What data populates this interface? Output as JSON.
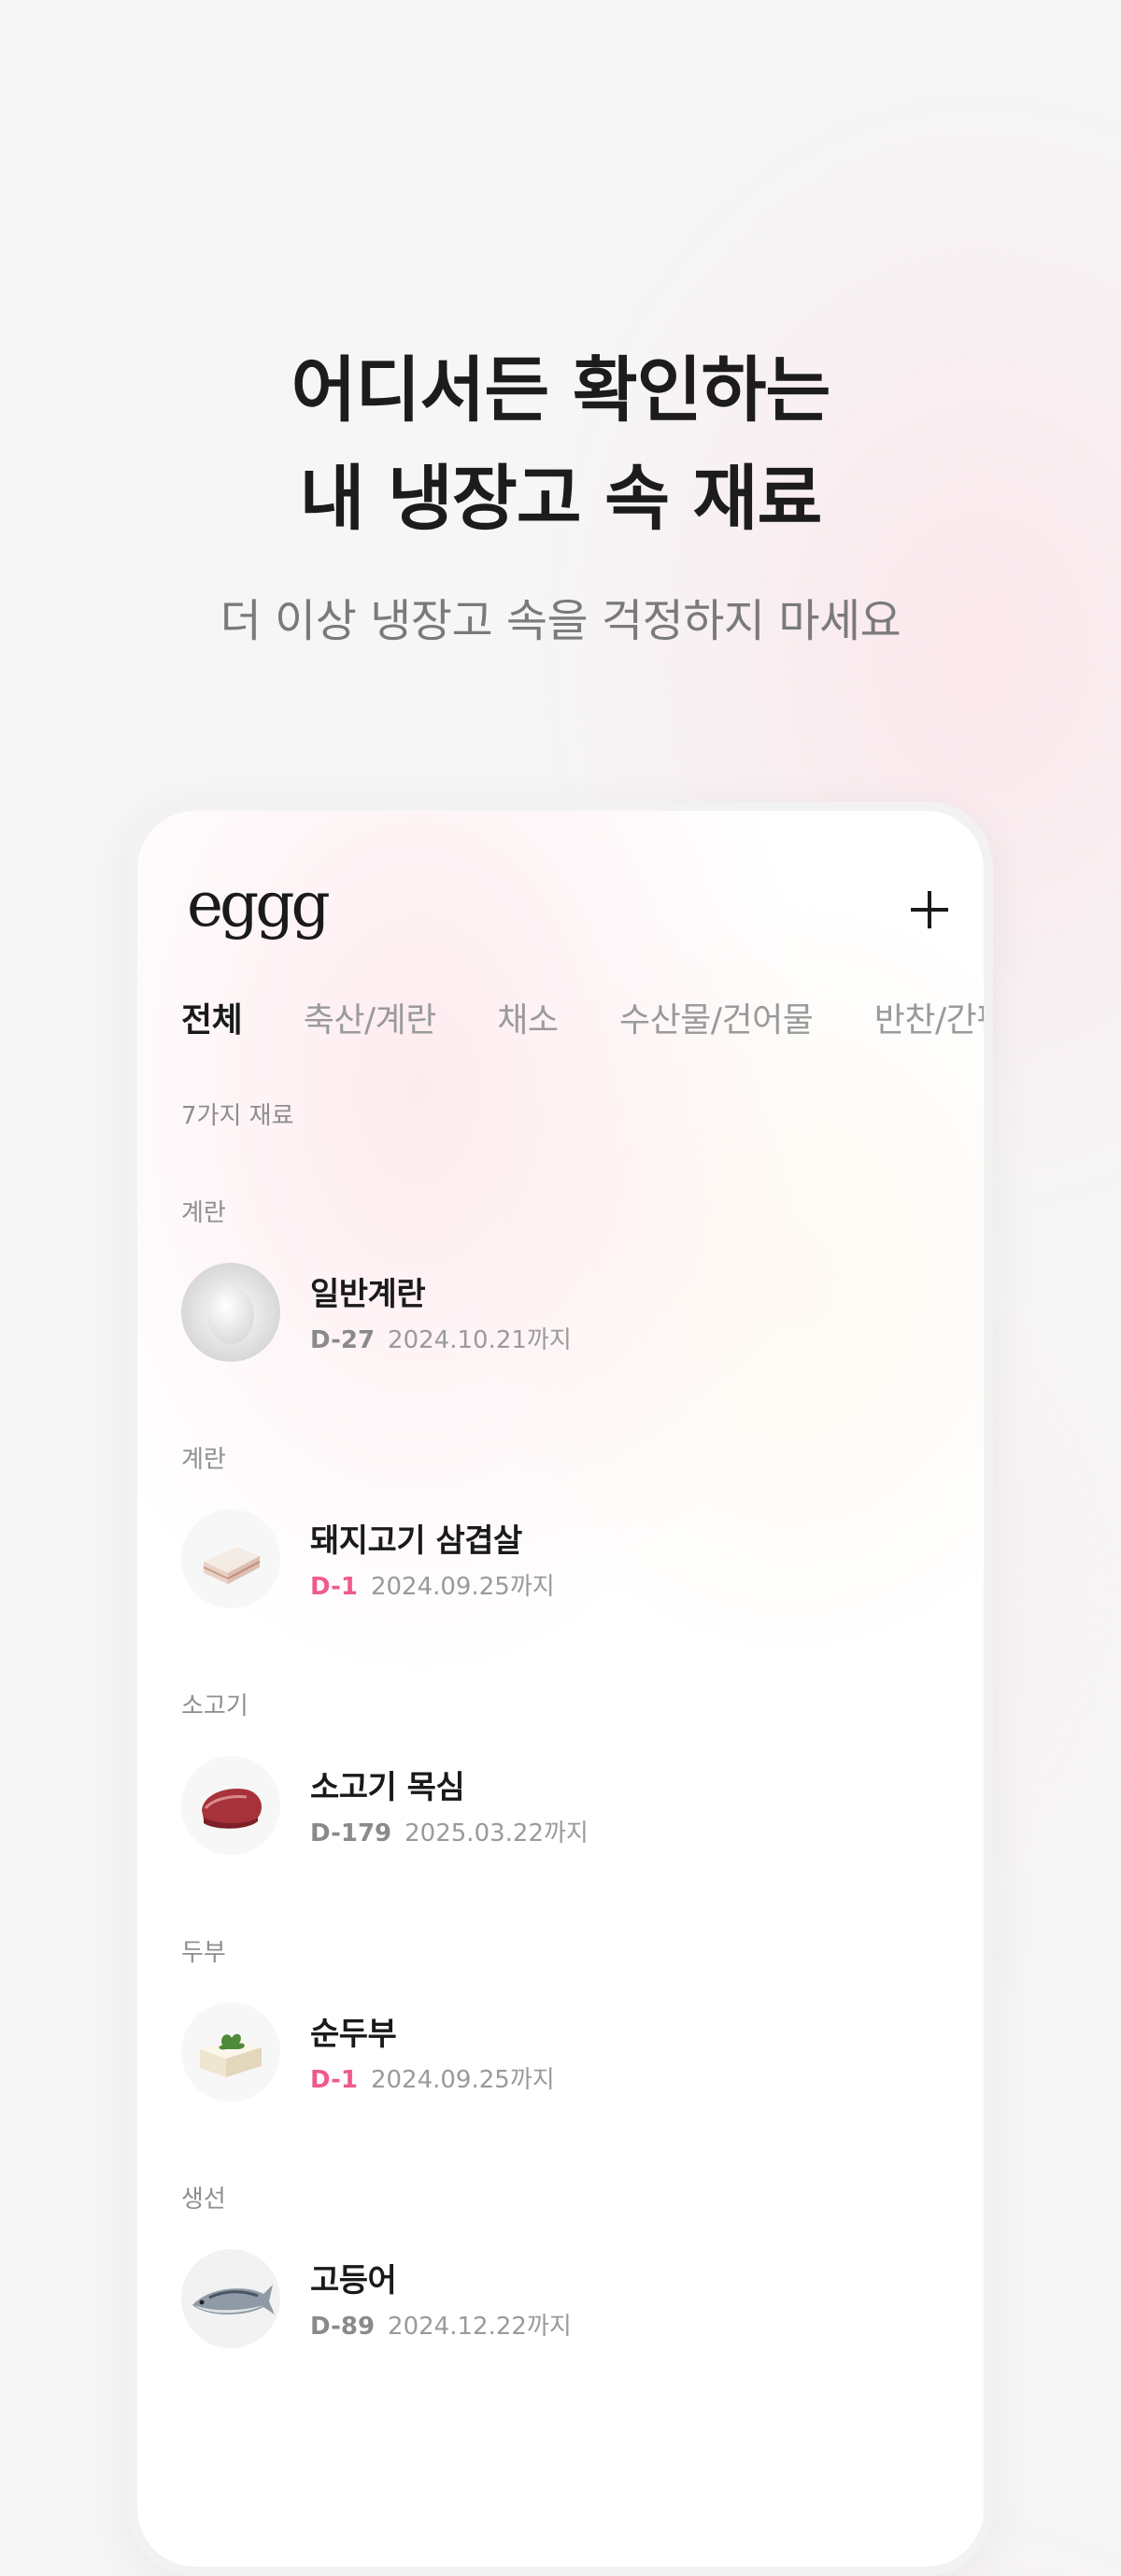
{
  "headline": {
    "line1": "어디서든 확인하는",
    "line2": "내 냉장고 속 재료"
  },
  "subheadline": "더 이상 냉장고 속을 걱정하지 마세요",
  "app": {
    "logo": "eggg",
    "add_icon": "plus-icon",
    "tabs": [
      {
        "label": "전체",
        "active": true
      },
      {
        "label": "축산/계란",
        "active": false
      },
      {
        "label": "채소",
        "active": false
      },
      {
        "label": "수산물/건어물",
        "active": false
      },
      {
        "label": "반찬/간편식",
        "active": false
      }
    ],
    "count_label": "7가지 재료",
    "sections": [
      {
        "category": "계란",
        "name": "일반계란",
        "dday": "D-27",
        "date": "2024.10.21까지",
        "urgent": false,
        "icon": "egg-icon"
      },
      {
        "category": "계란",
        "name": "돼지고기 삼겹살",
        "dday": "D-1",
        "date": "2024.09.25까지",
        "urgent": true,
        "icon": "pork-belly-icon"
      },
      {
        "category": "소고기",
        "name": "소고기 목심",
        "dday": "D-179",
        "date": "2025.03.22까지",
        "urgent": false,
        "icon": "beef-icon"
      },
      {
        "category": "두부",
        "name": "순두부",
        "dday": "D-1",
        "date": "2024.09.25까지",
        "urgent": true,
        "icon": "tofu-icon"
      },
      {
        "category": "생선",
        "name": "고등어",
        "dday": "D-89",
        "date": "2024.12.22까지",
        "urgent": false,
        "icon": "mackerel-icon"
      }
    ]
  },
  "colors": {
    "urgent": "#ef5a8d",
    "text": "#1a1a1a",
    "muted": "#9a9a9a"
  }
}
